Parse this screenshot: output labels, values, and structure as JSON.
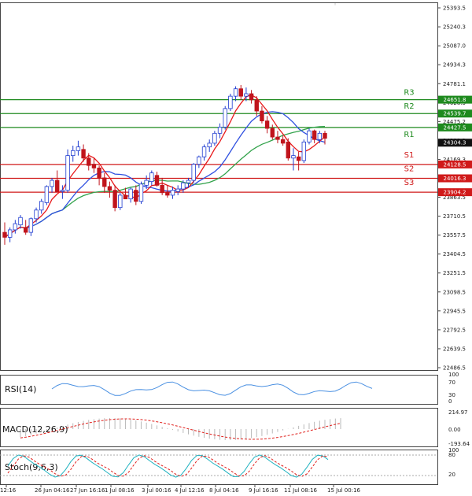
{
  "chart_data": {
    "type": "candlestick",
    "instrument_price_axis": {
      "ticks": [
        "25393.5",
        "25240.3",
        "25087.0",
        "24934.3",
        "24781.1",
        "24628.3",
        "24475.2",
        "24322.3",
        "24169.3",
        "24016.3",
        "23863.5",
        "23710.5",
        "23557.5",
        "23404.5",
        "23251.5",
        "23098.5",
        "22945.5",
        "22792.5",
        "22639.5",
        "22486.5"
      ],
      "min": 22486.5,
      "max": 25393.5
    },
    "x_ticks": [
      "12:16",
      "26 Jun 04:16",
      "27 Jun 16:16",
      "1 Jul 08:16",
      "3 Jul 00:16",
      "4 Jul 12:16",
      "8 Jul 04:16",
      "9 Jul 16:16",
      "11 Jul 08:16",
      "15 Jul 00:16"
    ],
    "current_price": "24304.3",
    "levels": [
      {
        "name": "R3",
        "value": 24651.8,
        "label": "24651.8",
        "color": "#1e8a1e"
      },
      {
        "name": "R2",
        "value": 24539.7,
        "label": "24539.7",
        "color": "#1e8a1e"
      },
      {
        "name": "R1",
        "value": 24427.5,
        "label": "24427.5",
        "color": "#1e8a1e"
      },
      {
        "name": "S1",
        "value": 24128.5,
        "label": "24128.5",
        "color": "#d01a1a"
      },
      {
        "name": "S2",
        "value": 24016.3,
        "label": "24016.3",
        "color": "#d01a1a"
      },
      {
        "name": "S3",
        "value": 23904.2,
        "label": "23904.2",
        "color": "#d01a1a"
      }
    ],
    "candles": [
      [
        23580,
        23660,
        23480,
        23540
      ],
      [
        23540,
        23620,
        23500,
        23600
      ],
      [
        23600,
        23680,
        23570,
        23650
      ],
      [
        23640,
        23720,
        23610,
        23700
      ],
      [
        23620,
        23680,
        23560,
        23580
      ],
      [
        23580,
        23700,
        23550,
        23690
      ],
      [
        23690,
        23780,
        23660,
        23760
      ],
      [
        23760,
        23850,
        23730,
        23830
      ],
      [
        23820,
        23960,
        23800,
        23950
      ],
      [
        23950,
        24020,
        23900,
        24000
      ],
      [
        24000,
        24080,
        23960,
        23910
      ],
      [
        23910,
        23960,
        23850,
        23920
      ],
      [
        23920,
        24250,
        23900,
        24200
      ],
      [
        24200,
        24280,
        24150,
        24240
      ],
      [
        24240,
        24320,
        24200,
        24270
      ],
      [
        24250,
        24290,
        24150,
        24180
      ],
      [
        24180,
        24220,
        24080,
        24120
      ],
      [
        24130,
        24180,
        24060,
        24100
      ],
      [
        24100,
        24120,
        23960,
        24020
      ],
      [
        24020,
        24060,
        23900,
        23950
      ],
      [
        23950,
        23990,
        23860,
        23920
      ],
      [
        23920,
        23960,
        23750,
        23780
      ],
      [
        23780,
        23900,
        23760,
        23880
      ],
      [
        23880,
        23940,
        23850,
        23850
      ],
      [
        23850,
        23940,
        23820,
        23930
      ],
      [
        23920,
        23960,
        23800,
        23830
      ],
      [
        23830,
        23990,
        23810,
        23970
      ],
      [
        23960,
        24040,
        23930,
        24000
      ],
      [
        23990,
        24080,
        23960,
        24060
      ],
      [
        24040,
        24070,
        23950,
        23960
      ],
      [
        23960,
        24020,
        23880,
        23900
      ],
      [
        23900,
        23960,
        23860,
        23880
      ],
      [
        23880,
        23950,
        23850,
        23920
      ],
      [
        23910,
        23960,
        23880,
        23930
      ],
      [
        23930,
        24000,
        23900,
        23980
      ],
      [
        23980,
        24020,
        23940,
        24000
      ],
      [
        24000,
        24140,
        23980,
        24130
      ],
      [
        24130,
        24200,
        24100,
        24190
      ],
      [
        24190,
        24290,
        24160,
        24270
      ],
      [
        24270,
        24330,
        24230,
        24300
      ],
      [
        24300,
        24400,
        24280,
        24380
      ],
      [
        24380,
        24460,
        24340,
        24430
      ],
      [
        24430,
        24600,
        24410,
        24580
      ],
      [
        24580,
        24700,
        24560,
        24680
      ],
      [
        24680,
        24760,
        24640,
        24740
      ],
      [
        24740,
        24770,
        24650,
        24680
      ],
      [
        24680,
        24750,
        24640,
        24700
      ],
      [
        24700,
        24730,
        24620,
        24650
      ],
      [
        24650,
        24680,
        24520,
        24560
      ],
      [
        24560,
        24600,
        24460,
        24480
      ],
      [
        24480,
        24520,
        24380,
        24420
      ],
      [
        24420,
        24450,
        24330,
        24350
      ],
      [
        24350,
        24400,
        24300,
        24330
      ],
      [
        24330,
        24360,
        24280,
        24300
      ],
      [
        24310,
        24340,
        24160,
        24180
      ],
      [
        24180,
        24260,
        24080,
        24200
      ],
      [
        24190,
        24230,
        24080,
        24160
      ],
      [
        24160,
        24330,
        24140,
        24310
      ],
      [
        24310,
        24420,
        24290,
        24400
      ],
      [
        24400,
        24410,
        24300,
        24330
      ],
      [
        24330,
        24400,
        24300,
        24380
      ],
      [
        24380,
        24400,
        24290,
        24340
      ]
    ],
    "indicators": [
      {
        "name": "RSI(14)",
        "ticks": [
          "100",
          "70",
          "30",
          "0"
        ]
      },
      {
        "name": "MACD(12,26,9)",
        "ticks": [
          "214.97",
          "0.00",
          "-193.64"
        ]
      },
      {
        "name": "Stoch(9,6,3)",
        "ticks": [
          "100",
          "80",
          "20"
        ]
      }
    ],
    "colors": {
      "up": "#1f3cd0",
      "down": "#c0141c",
      "ma_fast": "#e8191b",
      "ma_mid": "#2f50e0",
      "ma_slow": "#31a24a",
      "rsi": "#4a90e2",
      "macd_hist": "#b9b9b9",
      "macd_signal": "#e0201c",
      "stoch_main": "#20b2c0",
      "stoch_signal": "#e0201c"
    }
  }
}
